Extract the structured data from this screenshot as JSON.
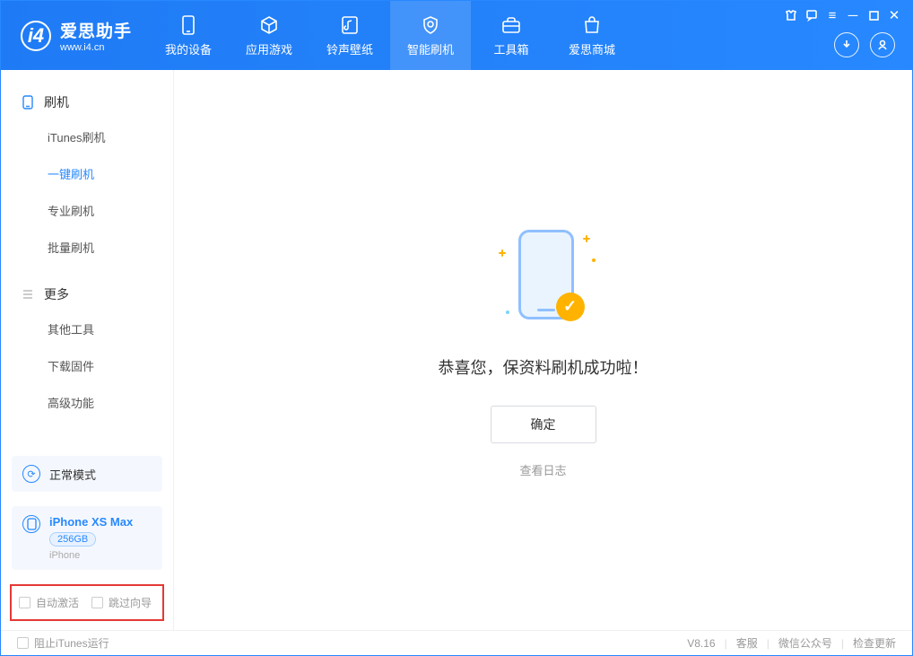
{
  "app": {
    "name_cn": "爱思助手",
    "name_en": "www.i4.cn"
  },
  "nav": [
    {
      "label": "我的设备",
      "icon": "phone-icon"
    },
    {
      "label": "应用游戏",
      "icon": "cube-icon"
    },
    {
      "label": "铃声壁纸",
      "icon": "music-icon"
    },
    {
      "label": "智能刷机",
      "icon": "shield-icon",
      "active": true
    },
    {
      "label": "工具箱",
      "icon": "toolbox-icon"
    },
    {
      "label": "爱思商城",
      "icon": "bag-icon"
    }
  ],
  "sidebar": {
    "group1": {
      "title": "刷机",
      "items": [
        "iTunes刷机",
        "一键刷机",
        "专业刷机",
        "批量刷机"
      ],
      "active_index": 1
    },
    "group2": {
      "title": "更多",
      "items": [
        "其他工具",
        "下载固件",
        "高级功能"
      ]
    }
  },
  "mode": {
    "label": "正常模式"
  },
  "device": {
    "name": "iPhone XS Max",
    "capacity": "256GB",
    "type": "iPhone"
  },
  "options": {
    "auto_activate": "自动激活",
    "skip_guide": "跳过向导"
  },
  "main": {
    "success_message": "恭喜您，保资料刷机成功啦！",
    "ok_button": "确定",
    "view_log": "查看日志"
  },
  "footer": {
    "block_itunes": "阻止iTunes运行",
    "version": "V8.16",
    "links": [
      "客服",
      "微信公众号",
      "检查更新"
    ]
  }
}
